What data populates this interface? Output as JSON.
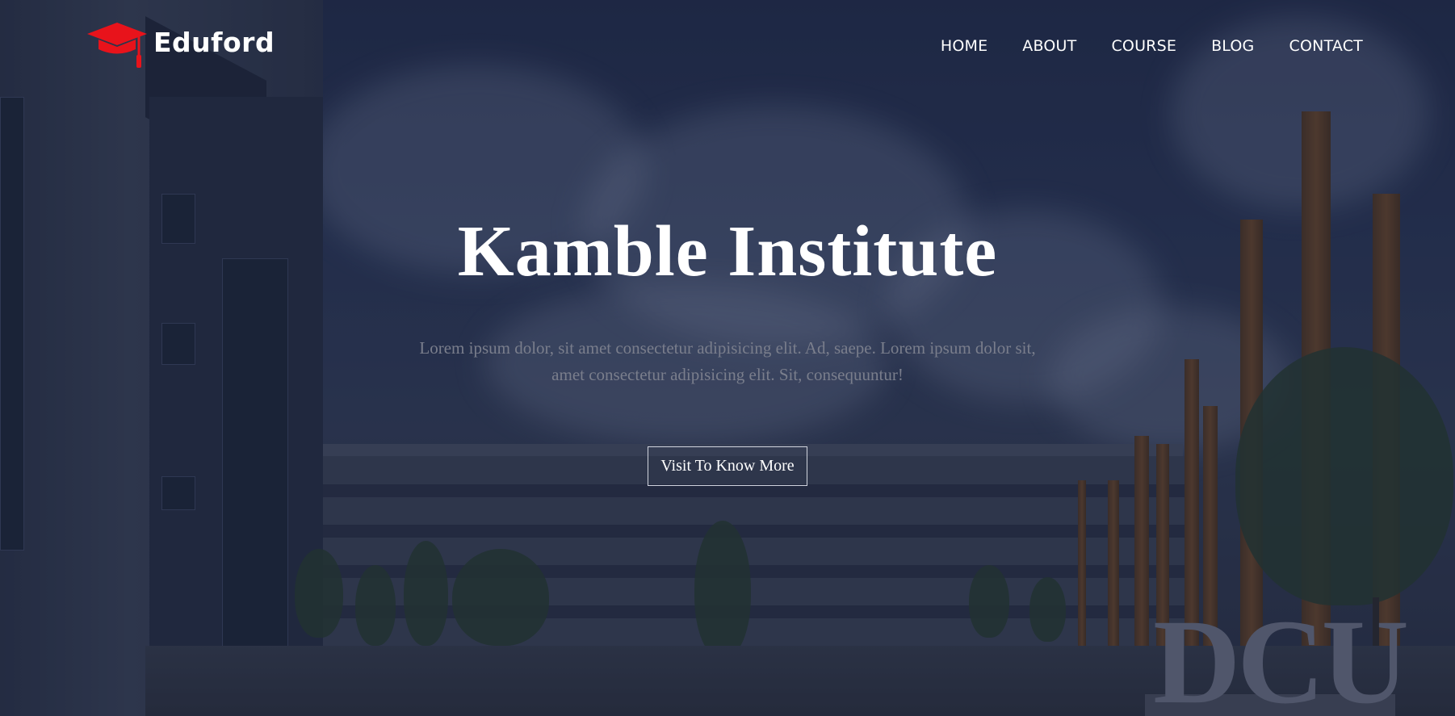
{
  "brand": {
    "name": "Eduford",
    "accent_color": "#e8131b",
    "icon": "graduation-cap-icon"
  },
  "nav": {
    "items": [
      {
        "label": "HOME"
      },
      {
        "label": "ABOUT"
      },
      {
        "label": "COURSE"
      },
      {
        "label": "BLOG"
      },
      {
        "label": "CONTACT"
      }
    ]
  },
  "hero": {
    "title": "Kamble Institute",
    "description": "Lorem ipsum dolor, sit amet consectetur adipisicing elit. Ad, saepe. Lorem ipsum dolor sit, amet consectetur adipisicing elit. Sit, consequuntur!",
    "cta_label": "Visit To Know More",
    "background_sign": "DCU"
  }
}
